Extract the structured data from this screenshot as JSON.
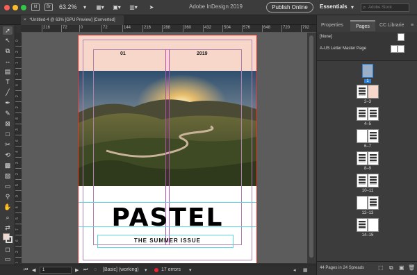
{
  "app": {
    "title": "Adobe InDesign 2019",
    "zoom": "63.2%",
    "publish_label": "Publish Online",
    "workspace": "Essentials",
    "stock_placeholder": "Adobe Stock",
    "icon_id": "Id",
    "icon_br": "Br",
    "icon_st": "St"
  },
  "document_tab": {
    "close": "×",
    "label": "*Untitled-4 @ 63% [GPU Preview] [Converted]"
  },
  "ruler_h": [
    "216",
    "72",
    "0",
    "72",
    "144",
    "216",
    "288",
    "360",
    "432",
    "504",
    "576",
    "648",
    "720",
    "792"
  ],
  "ruler_v": [
    "0",
    "2",
    "1",
    "1",
    "4",
    "2",
    "2",
    "8",
    "3",
    "6",
    "4",
    "3",
    "2",
    "5",
    "0",
    "4",
    "5",
    "7",
    "6",
    "2",
    "0"
  ],
  "page": {
    "issue_number": "01",
    "year": "2019",
    "title": "PASTEL",
    "subtitle": "THE SUMMER ISSUE"
  },
  "status": {
    "page_number": "1",
    "style": "[Basic] (working)",
    "errors": "17 errors"
  },
  "panel": {
    "tabs": [
      "Properties",
      "Pages",
      "CC Librarie"
    ],
    "masters": [
      "[None]",
      "A-US Letter Master Page"
    ],
    "spreads": [
      "1",
      "2–3",
      "4–5",
      "6–7",
      "8–9",
      "10–11",
      "12–13",
      "14–15"
    ],
    "footer": "44 Pages in 24 Spreads"
  },
  "colors": {
    "accent": "#2d7fd3",
    "page_bg": "#f6d7c9",
    "error": "#e22233"
  }
}
